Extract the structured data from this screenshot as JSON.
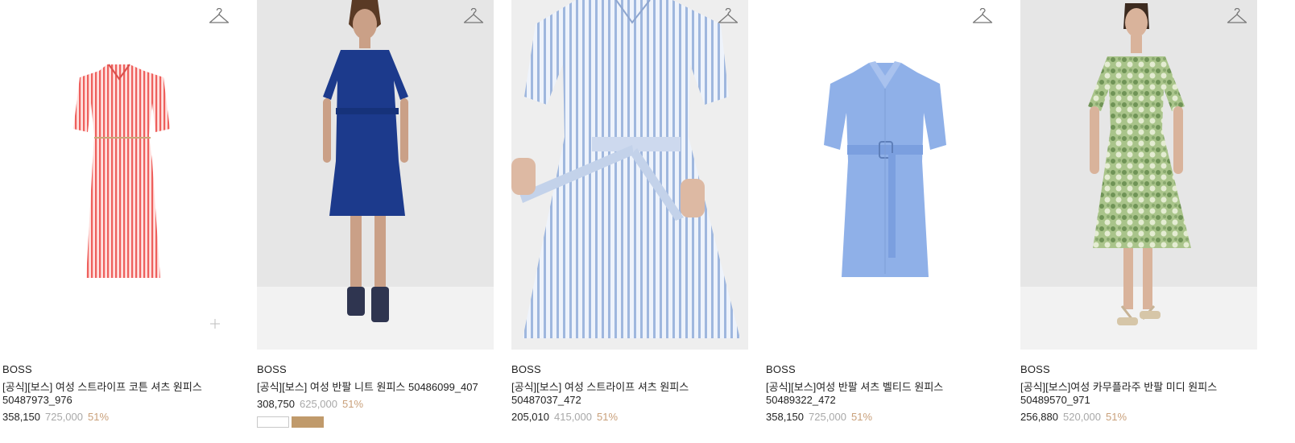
{
  "products": [
    {
      "brand": "BOSS",
      "name": "[공식][보스] 여성 스트라이프 코튼 셔츠 원피스 50487973_976",
      "price": "358,150",
      "original_price": "725,000",
      "discount": "51%"
    },
    {
      "brand": "BOSS",
      "name": "[공식][보스] 여성 반팔 니트 원피스 50486099_407",
      "price": "308,750",
      "original_price": "625,000",
      "discount": "51%"
    },
    {
      "brand": "BOSS",
      "name": "[공식][보스] 여성 스트라이프 셔츠 원피스 50487037_472",
      "price": "205,010",
      "original_price": "415,000",
      "discount": "51%"
    },
    {
      "brand": "BOSS",
      "name": "[공식][보스]여성 반팔 셔츠 벨티드 원피스 50489322_472",
      "price": "358,150",
      "original_price": "725,000",
      "discount": "51%"
    },
    {
      "brand": "BOSS",
      "name": "[공식][보스]여성 카무플라주 반팔 미디 원피스 50489570_971",
      "price": "256,880",
      "original_price": "520,000",
      "discount": "51%"
    }
  ],
  "icons": {
    "wishlist": "hanger-icon",
    "add": "plus-icon"
  },
  "colors": {
    "discount": "#c9a07a",
    "original_price": "#a8a8a8",
    "tag_accent": "#c09a6b"
  }
}
